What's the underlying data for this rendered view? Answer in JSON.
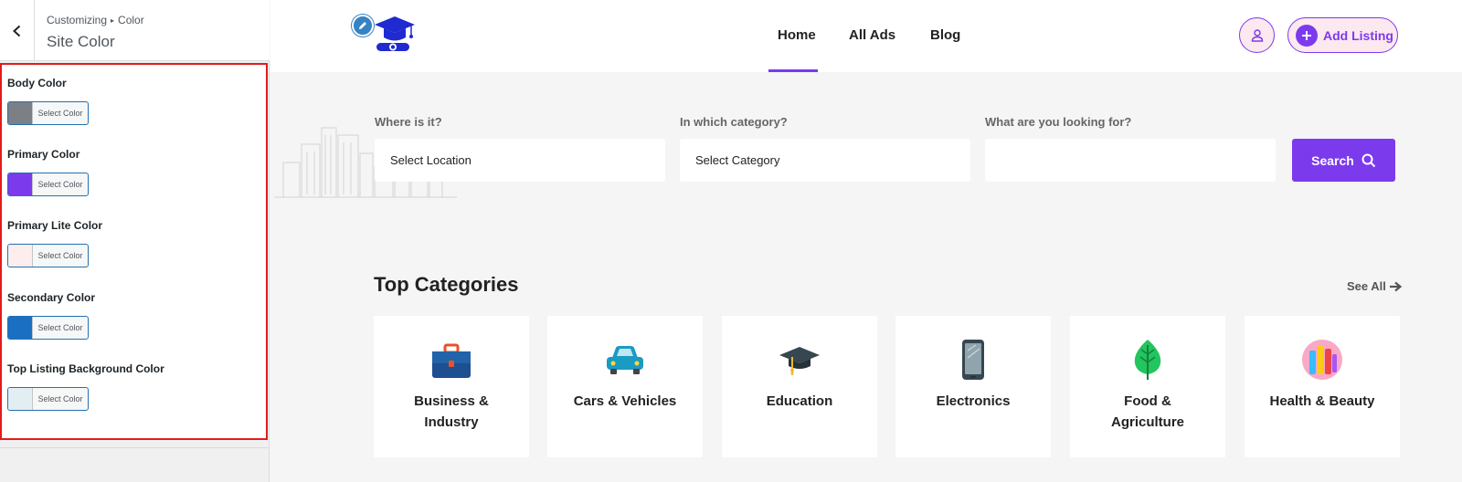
{
  "customizer": {
    "breadcrumb_root": "Customizing",
    "breadcrumb_sep": "▸",
    "breadcrumb_section": "Color",
    "title": "Site Color",
    "controls": [
      {
        "label": "Body Color",
        "button": "Select Color",
        "color": "#7b7f86"
      },
      {
        "label": "Primary Color",
        "button": "Select Color",
        "color": "#7c3aed"
      },
      {
        "label": "Primary Lite Color",
        "button": "Select Color",
        "color": "#fdeded"
      },
      {
        "label": "Secondary Color",
        "button": "Select Color",
        "color": "#1b6fc2"
      },
      {
        "label": "Top Listing Background Color",
        "button": "Select Color",
        "color": "#e3eef3"
      }
    ]
  },
  "site": {
    "nav": {
      "home": "Home",
      "all_ads": "All Ads",
      "blog": "Blog"
    },
    "add_listing": "Add Listing",
    "search": {
      "location_label": "Where is it?",
      "location_placeholder": "Select Location",
      "category_label": "In which category?",
      "category_placeholder": "Select Category",
      "keyword_label": "What are you looking for?",
      "keyword_value": "",
      "button": "Search"
    },
    "categories_title": "Top Categories",
    "see_all": "See All",
    "categories": [
      {
        "line1": "Business &",
        "line2": "Industry",
        "icon": "briefcase-icon"
      },
      {
        "line1": "Cars & Vehicles",
        "line2": "",
        "icon": "car-icon"
      },
      {
        "line1": "Education",
        "line2": "",
        "icon": "graduation-cap-icon"
      },
      {
        "line1": "Electronics",
        "line2": "",
        "icon": "smartphone-icon"
      },
      {
        "line1": "Food &",
        "line2": "Agriculture",
        "icon": "leaf-icon"
      },
      {
        "line1": "Health & Beauty",
        "line2": "",
        "icon": "cosmetics-icon"
      }
    ]
  },
  "colors": {
    "accent": "#7c3aed",
    "accent_lite": "#fce8ef",
    "highlight_border": "#e31b1b",
    "wp_blue": "#2271b1"
  }
}
